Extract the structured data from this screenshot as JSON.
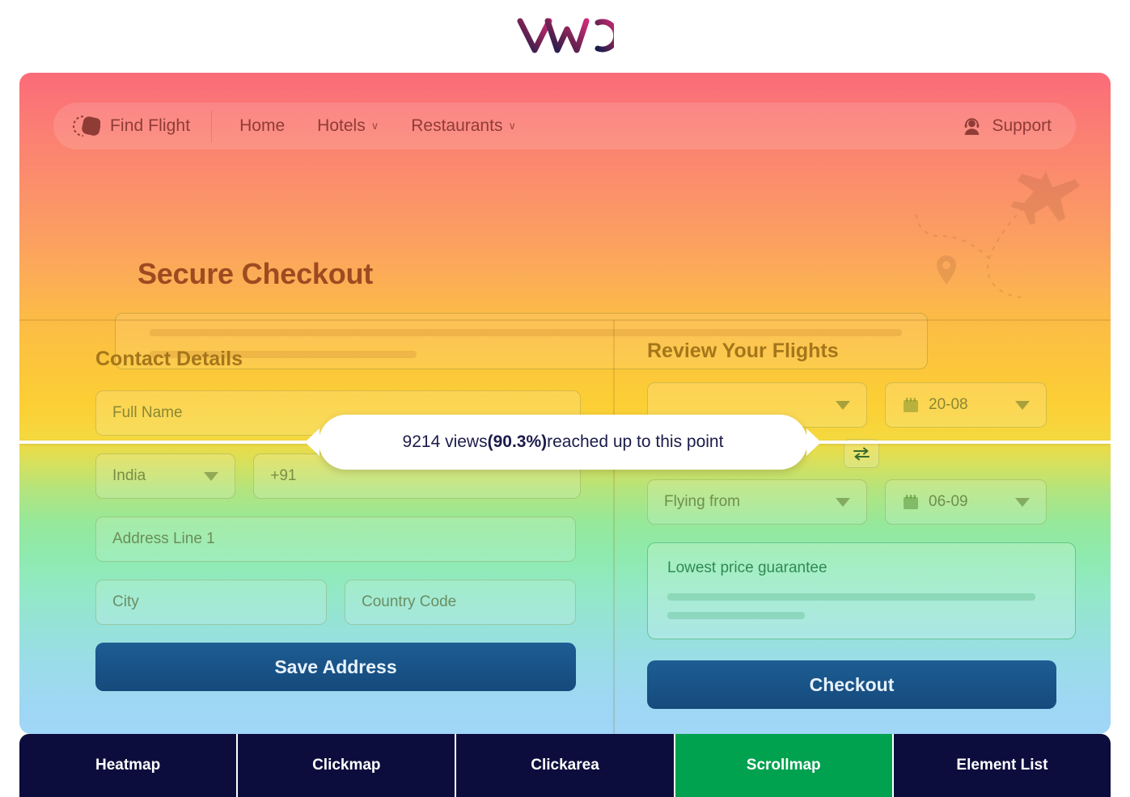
{
  "brand": {
    "logo_name": "vwo-logo",
    "logo_alt": "VWO"
  },
  "site_nav": {
    "brand_label": "Find Flight",
    "brand_icon": "flight-diamond-icon",
    "links": [
      {
        "label": "Home",
        "has_caret": false,
        "caret": ""
      },
      {
        "label": "Hotels",
        "has_caret": true,
        "caret": "∨"
      },
      {
        "label": "Restaurants",
        "has_caret": true,
        "caret": "∨"
      }
    ],
    "support": {
      "label": "Support",
      "icon": "headset-agent-icon"
    }
  },
  "hero": {
    "title": "Secure Checkout",
    "placeholder_bars": 2
  },
  "contact": {
    "title": "Contact Details",
    "full_name_placeholder": "Full Name",
    "country_value": "India",
    "phone_code_placeholder": "+91",
    "address_placeholder": "Address Line 1",
    "city_placeholder": "City",
    "country_code_placeholder": "Country Code",
    "save_label": "Save Address"
  },
  "flights": {
    "title": "Review Your Flights",
    "flying_to_placeholder": "",
    "depart_date": "20-08",
    "swap_icon": "swap-arrows-icon",
    "flying_from_placeholder": "Flying from",
    "return_date": "06-09",
    "calendar_icon": "calendar-icon",
    "guarantee_title": "Lowest price guarantee",
    "checkout_label": "Checkout"
  },
  "scroll_tooltip": {
    "prefix": "9214 views ",
    "percent": "(90.3%)",
    "suffix": " reached up to this point",
    "views": 9214,
    "percent_value": 90.3
  },
  "tabs": {
    "items": [
      {
        "label": "Heatmap",
        "active": false
      },
      {
        "label": "Clickmap",
        "active": false
      },
      {
        "label": "Clickarea",
        "active": false
      },
      {
        "label": "Scrollmap",
        "active": true
      },
      {
        "label": "Element List",
        "active": false
      }
    ],
    "active_color": "#00a14f",
    "bar_color": "#0d0d3d"
  },
  "colors": {
    "heat_top": "#fb6b79",
    "heat_mid": "#fccf35",
    "heat_bottom": "#a0d6f7",
    "scroll_marker": "#ffffff",
    "cta": "#1d5d93"
  }
}
